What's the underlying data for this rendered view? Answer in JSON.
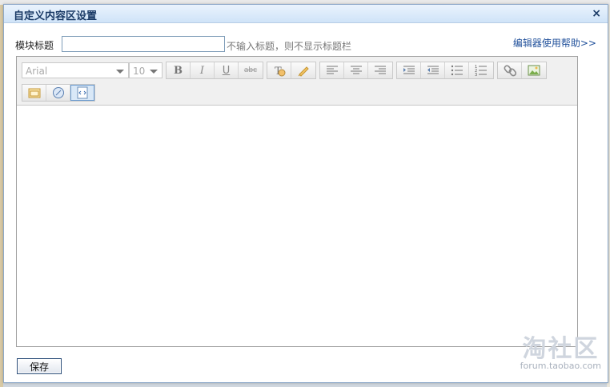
{
  "dialog": {
    "title": "自定义内容区设置",
    "close_label": "×"
  },
  "module_title": {
    "label": "模块标题",
    "value": "",
    "hint": "不输入标题，则不显示标题栏",
    "help_link": "编辑器使用帮助>>"
  },
  "toolbar": {
    "font_family": "Arial",
    "font_size": "10",
    "buttons": {
      "bold": "B",
      "italic": "I",
      "underline": "U",
      "strikethrough": "abc"
    }
  },
  "footer": {
    "save_label": "保存"
  },
  "watermark": {
    "logo": "淘社区",
    "url": "forum.taobao.com"
  }
}
